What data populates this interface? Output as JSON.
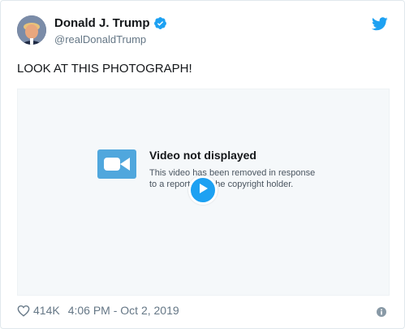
{
  "user": {
    "display_name": "Donald J. Trump",
    "handle": "@realDonaldTrump",
    "verified_icon": "verified-badge-icon",
    "avatar": "profile-photo"
  },
  "tweet": {
    "text": "LOOK AT THIS PHOTOGRAPH!"
  },
  "media": {
    "icon": "video-camera-icon",
    "title": "Video not displayed",
    "message": "This video has been removed in response to a report from the copyright holder.",
    "play_icon": "play-icon"
  },
  "footer": {
    "like_icon": "heart-icon",
    "likes": "414K",
    "timestamp": "4:06 PM - Oct 2, 2019",
    "info_icon": "info-icon"
  },
  "colors": {
    "accent": "#1da1f2",
    "text": "#14171a",
    "secondary": "#657786",
    "media_bg": "#f5f8fa"
  }
}
